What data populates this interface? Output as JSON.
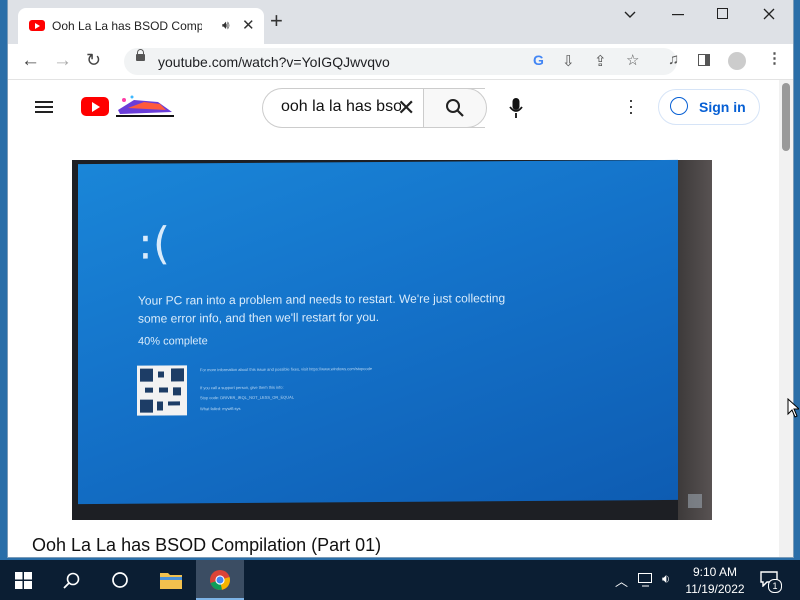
{
  "browser": {
    "tab_title": "Ooh La La has BSOD Compil",
    "new_tab_glyph": "+",
    "url": "youtube.com/watch?v=YoIGQJwvqvo",
    "window_controls": {
      "minimize": "—",
      "maximize": "☐",
      "close": "✕"
    }
  },
  "youtube": {
    "search_value": "ooh la la has bsod",
    "signin_label": "Sign in",
    "video_title": "Ooh La La has BSOD Compilation (Part 01)"
  },
  "bsod": {
    "sad_face": ":(",
    "message": "Your PC ran into a problem and needs to restart. We're just collecting some error info, and then we'll restart for you.",
    "progress_text": "40% complete",
    "progress_percent": 40,
    "fine_print": [
      "For more information about this issue and possible fixes, visit https://www.windows.com/stopcode",
      "If you call a support person, give them this info:",
      "Stop code: DRIVER_IRQL_NOT_LESS_OR_EQUAL",
      "What failed: mywifi.sys"
    ]
  },
  "taskbar": {
    "time": "9:10 AM",
    "date": "11/19/2022",
    "notification_count": "1"
  },
  "colors": {
    "youtube_red": "#ff0000",
    "bsod_blue": "#1472c9",
    "taskbar": "#0b1e33",
    "signin_blue": "#065fd4"
  }
}
